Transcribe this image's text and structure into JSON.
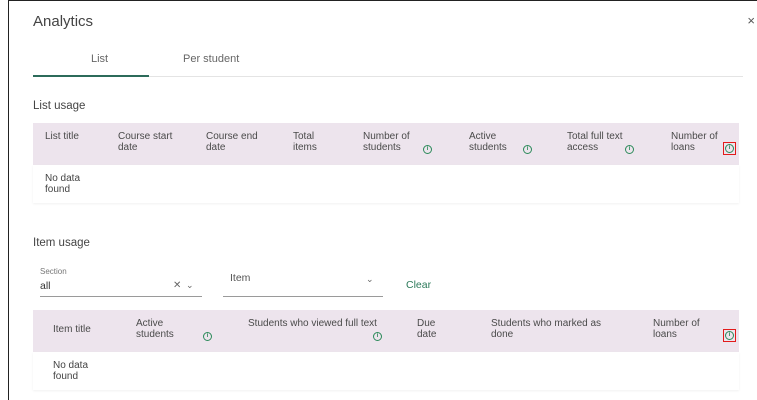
{
  "dialog": {
    "title": "Analytics",
    "close_glyph": "×"
  },
  "tabs": [
    {
      "label": "List"
    },
    {
      "label": "Per student"
    }
  ],
  "list_usage": {
    "heading": "List usage",
    "columns": [
      {
        "label": "List title"
      },
      {
        "label": "Course start date"
      },
      {
        "label": "Course end date"
      },
      {
        "label": "Total items"
      },
      {
        "label": "Number of students"
      },
      {
        "label": "Active students"
      },
      {
        "label": "Total full text access"
      },
      {
        "label": "Number of loans"
      }
    ],
    "empty_text": "No data found"
  },
  "item_usage": {
    "heading": "Item usage",
    "section_filter": {
      "label": "Section",
      "value": "all"
    },
    "item_filter": {
      "placeholder": "Item"
    },
    "clear_label": "Clear",
    "columns": [
      {
        "label": "Item title"
      },
      {
        "label": "Active students"
      },
      {
        "label": "Students who viewed full text"
      },
      {
        "label": "Due date"
      },
      {
        "label": "Students who marked as done"
      },
      {
        "label": "Number of loans"
      }
    ],
    "empty_text": "No data found"
  },
  "icons": {
    "info": "info-icon",
    "close": "close-icon",
    "chevron": "chevron-down-icon",
    "clear": "clear-x-icon"
  },
  "colors": {
    "header_bg": "#ede4ed",
    "accent": "#2c6b5a",
    "highlight": "#e21b1b"
  }
}
